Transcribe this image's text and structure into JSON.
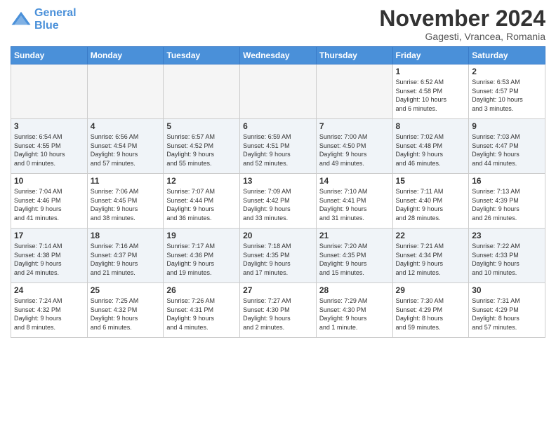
{
  "header": {
    "logo_line1": "General",
    "logo_line2": "Blue",
    "month": "November 2024",
    "location": "Gagesti, Vrancea, Romania"
  },
  "weekdays": [
    "Sunday",
    "Monday",
    "Tuesday",
    "Wednesday",
    "Thursday",
    "Friday",
    "Saturday"
  ],
  "weeks": [
    [
      {
        "day": "",
        "info": ""
      },
      {
        "day": "",
        "info": ""
      },
      {
        "day": "",
        "info": ""
      },
      {
        "day": "",
        "info": ""
      },
      {
        "day": "",
        "info": ""
      },
      {
        "day": "1",
        "info": "Sunrise: 6:52 AM\nSunset: 4:58 PM\nDaylight: 10 hours\nand 6 minutes."
      },
      {
        "day": "2",
        "info": "Sunrise: 6:53 AM\nSunset: 4:57 PM\nDaylight: 10 hours\nand 3 minutes."
      }
    ],
    [
      {
        "day": "3",
        "info": "Sunrise: 6:54 AM\nSunset: 4:55 PM\nDaylight: 10 hours\nand 0 minutes."
      },
      {
        "day": "4",
        "info": "Sunrise: 6:56 AM\nSunset: 4:54 PM\nDaylight: 9 hours\nand 57 minutes."
      },
      {
        "day": "5",
        "info": "Sunrise: 6:57 AM\nSunset: 4:52 PM\nDaylight: 9 hours\nand 55 minutes."
      },
      {
        "day": "6",
        "info": "Sunrise: 6:59 AM\nSunset: 4:51 PM\nDaylight: 9 hours\nand 52 minutes."
      },
      {
        "day": "7",
        "info": "Sunrise: 7:00 AM\nSunset: 4:50 PM\nDaylight: 9 hours\nand 49 minutes."
      },
      {
        "day": "8",
        "info": "Sunrise: 7:02 AM\nSunset: 4:48 PM\nDaylight: 9 hours\nand 46 minutes."
      },
      {
        "day": "9",
        "info": "Sunrise: 7:03 AM\nSunset: 4:47 PM\nDaylight: 9 hours\nand 44 minutes."
      }
    ],
    [
      {
        "day": "10",
        "info": "Sunrise: 7:04 AM\nSunset: 4:46 PM\nDaylight: 9 hours\nand 41 minutes."
      },
      {
        "day": "11",
        "info": "Sunrise: 7:06 AM\nSunset: 4:45 PM\nDaylight: 9 hours\nand 38 minutes."
      },
      {
        "day": "12",
        "info": "Sunrise: 7:07 AM\nSunset: 4:44 PM\nDaylight: 9 hours\nand 36 minutes."
      },
      {
        "day": "13",
        "info": "Sunrise: 7:09 AM\nSunset: 4:42 PM\nDaylight: 9 hours\nand 33 minutes."
      },
      {
        "day": "14",
        "info": "Sunrise: 7:10 AM\nSunset: 4:41 PM\nDaylight: 9 hours\nand 31 minutes."
      },
      {
        "day": "15",
        "info": "Sunrise: 7:11 AM\nSunset: 4:40 PM\nDaylight: 9 hours\nand 28 minutes."
      },
      {
        "day": "16",
        "info": "Sunrise: 7:13 AM\nSunset: 4:39 PM\nDaylight: 9 hours\nand 26 minutes."
      }
    ],
    [
      {
        "day": "17",
        "info": "Sunrise: 7:14 AM\nSunset: 4:38 PM\nDaylight: 9 hours\nand 24 minutes."
      },
      {
        "day": "18",
        "info": "Sunrise: 7:16 AM\nSunset: 4:37 PM\nDaylight: 9 hours\nand 21 minutes."
      },
      {
        "day": "19",
        "info": "Sunrise: 7:17 AM\nSunset: 4:36 PM\nDaylight: 9 hours\nand 19 minutes."
      },
      {
        "day": "20",
        "info": "Sunrise: 7:18 AM\nSunset: 4:35 PM\nDaylight: 9 hours\nand 17 minutes."
      },
      {
        "day": "21",
        "info": "Sunrise: 7:20 AM\nSunset: 4:35 PM\nDaylight: 9 hours\nand 15 minutes."
      },
      {
        "day": "22",
        "info": "Sunrise: 7:21 AM\nSunset: 4:34 PM\nDaylight: 9 hours\nand 12 minutes."
      },
      {
        "day": "23",
        "info": "Sunrise: 7:22 AM\nSunset: 4:33 PM\nDaylight: 9 hours\nand 10 minutes."
      }
    ],
    [
      {
        "day": "24",
        "info": "Sunrise: 7:24 AM\nSunset: 4:32 PM\nDaylight: 9 hours\nand 8 minutes."
      },
      {
        "day": "25",
        "info": "Sunrise: 7:25 AM\nSunset: 4:32 PM\nDaylight: 9 hours\nand 6 minutes."
      },
      {
        "day": "26",
        "info": "Sunrise: 7:26 AM\nSunset: 4:31 PM\nDaylight: 9 hours\nand 4 minutes."
      },
      {
        "day": "27",
        "info": "Sunrise: 7:27 AM\nSunset: 4:30 PM\nDaylight: 9 hours\nand 2 minutes."
      },
      {
        "day": "28",
        "info": "Sunrise: 7:29 AM\nSunset: 4:30 PM\nDaylight: 9 hours\nand 1 minute."
      },
      {
        "day": "29",
        "info": "Sunrise: 7:30 AM\nSunset: 4:29 PM\nDaylight: 8 hours\nand 59 minutes."
      },
      {
        "day": "30",
        "info": "Sunrise: 7:31 AM\nSunset: 4:29 PM\nDaylight: 8 hours\nand 57 minutes."
      }
    ]
  ]
}
